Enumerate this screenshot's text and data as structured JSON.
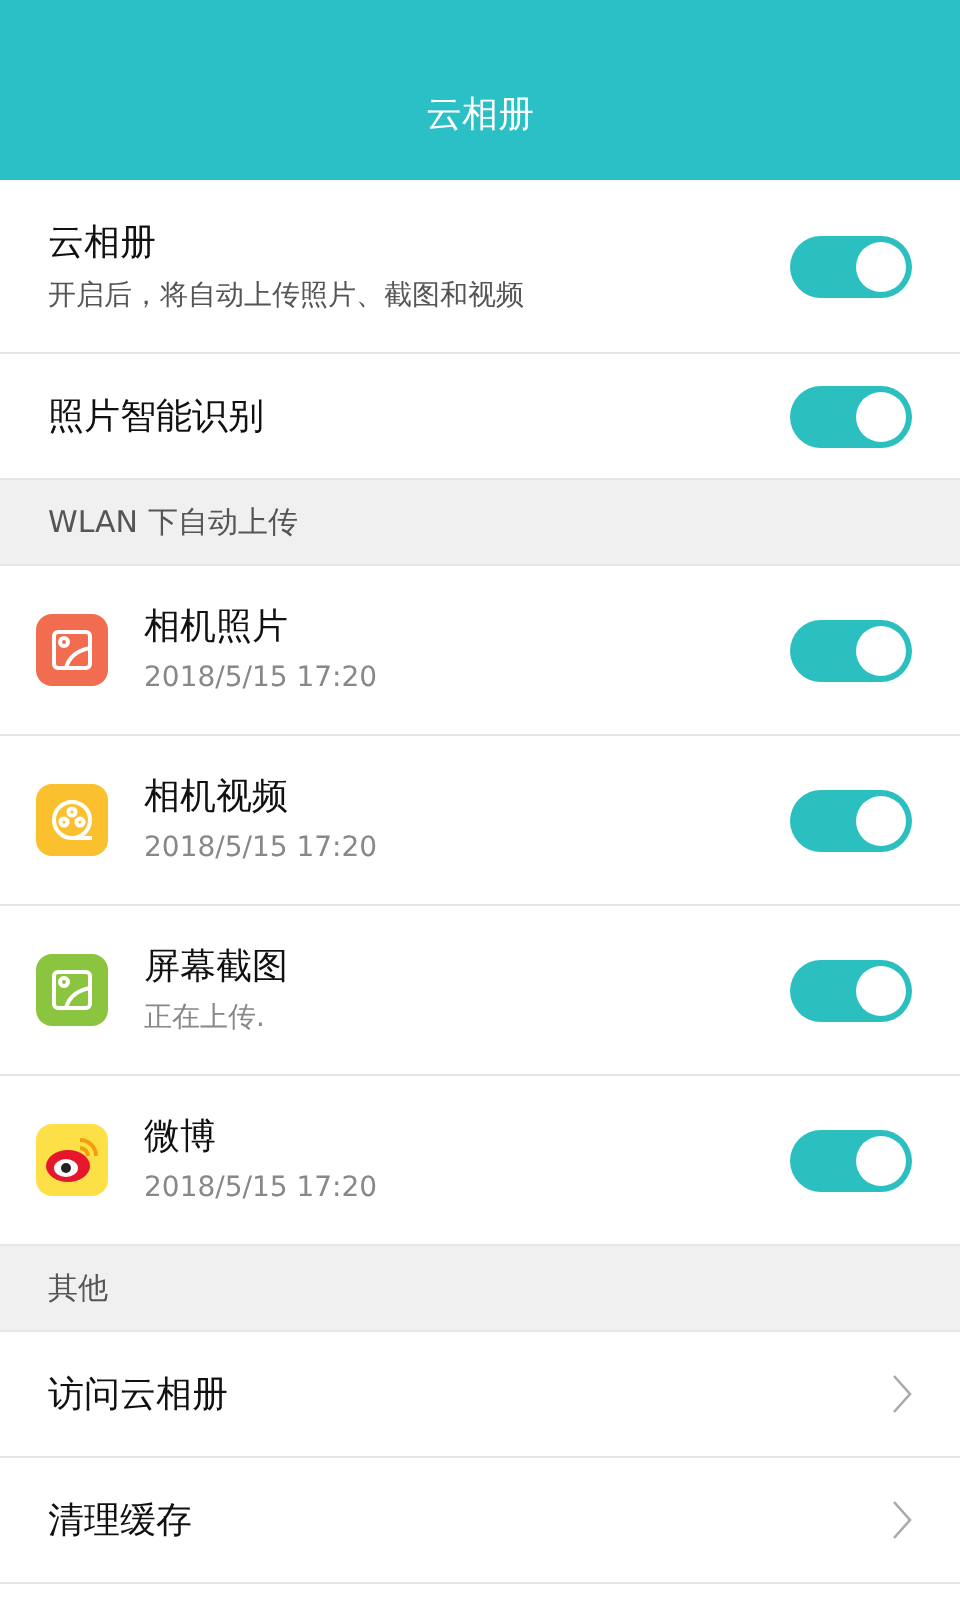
{
  "title": "云相册",
  "main": [
    {
      "title": "云相册",
      "subtitle": "开启后，将自动上传照片、截图和视频",
      "on": true
    },
    {
      "title": "照片智能识别",
      "on": true
    }
  ],
  "upload_section": {
    "header": "WLAN 下自动上传",
    "items": [
      {
        "kind": "photo",
        "color": "#f26d4f",
        "title": "相机照片",
        "subtitle": "2018/5/15 17:20",
        "on": true
      },
      {
        "kind": "video",
        "color": "#fbc02d",
        "title": "相机视频",
        "subtitle": "2018/5/15 17:20",
        "on": true
      },
      {
        "kind": "photo",
        "color": "#8bc53f",
        "title": "屏幕截图",
        "subtitle": "正在上传.",
        "on": true
      },
      {
        "kind": "weibo",
        "color": "#fde047",
        "title": "微博",
        "subtitle": "2018/5/15 17:20",
        "on": true
      }
    ]
  },
  "other_section": {
    "header": "其他",
    "links": [
      {
        "title": "访问云相册"
      },
      {
        "title": "清理缓存"
      }
    ]
  }
}
